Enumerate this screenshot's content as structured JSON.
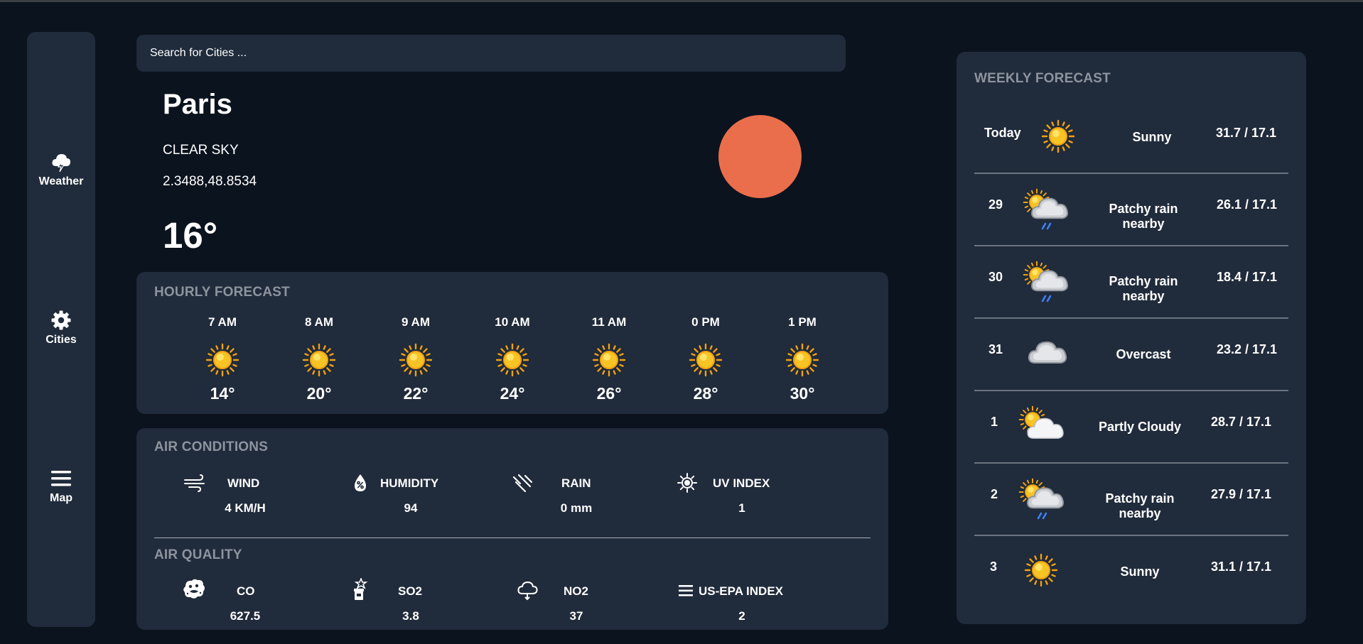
{
  "search": {
    "placeholder": "Search for Cities ..."
  },
  "sidebar": {
    "items": [
      {
        "label": "Weather",
        "icon": "cloud-lightning-icon"
      },
      {
        "label": "Cities",
        "icon": "gear-icon"
      },
      {
        "label": "Map",
        "icon": "menu-icon"
      }
    ]
  },
  "current": {
    "city": "Paris",
    "condition": "CLEAR SKY",
    "coords": "2.3488,48.8534",
    "temp": "16°",
    "icon": "sun-disc-icon",
    "accent": "#ea6e4b"
  },
  "hourly": {
    "title": "HOURLY FORECAST",
    "items": [
      {
        "time": "7 AM",
        "temp": "14°",
        "icon": "sun-icon"
      },
      {
        "time": "8 AM",
        "temp": "20°",
        "icon": "sun-icon"
      },
      {
        "time": "9 AM",
        "temp": "22°",
        "icon": "sun-icon"
      },
      {
        "time": "10 AM",
        "temp": "24°",
        "icon": "sun-icon"
      },
      {
        "time": "11 AM",
        "temp": "26°",
        "icon": "sun-icon"
      },
      {
        "time": "0 PM",
        "temp": "28°",
        "icon": "sun-icon"
      },
      {
        "time": "1 PM",
        "temp": "30°",
        "icon": "sun-icon"
      }
    ]
  },
  "air_conditions": {
    "title": "AIR CONDITIONS",
    "items": [
      {
        "label": "WIND",
        "value": "4 KM/H",
        "icon": "wind-icon"
      },
      {
        "label": "HUMIDITY",
        "value": "94",
        "icon": "humidity-drop-icon"
      },
      {
        "label": "RAIN",
        "value": "0 mm",
        "icon": "rain-icon"
      },
      {
        "label": "UV INDEX",
        "value": "1",
        "icon": "sun-outline-icon"
      }
    ]
  },
  "air_quality": {
    "title": "AIR QUALITY",
    "items": [
      {
        "label": "CO",
        "value": "627.5",
        "icon": "smog-icon"
      },
      {
        "label": "SO2",
        "value": "3.8",
        "icon": "chemical-bottle-icon"
      },
      {
        "label": "NO2",
        "value": "37",
        "icon": "cloud-outline-icon"
      },
      {
        "label": "US-EPA INDEX",
        "value": "2",
        "icon": "menu-icon"
      }
    ]
  },
  "weekly": {
    "title": "WEEKLY FORECAST",
    "days": [
      {
        "day": "Today",
        "condition": "Sunny",
        "temps": "31.7 / 17.1",
        "icon": "sun-icon"
      },
      {
        "day": "29",
        "condition": "Patchy rain nearby",
        "temps": "26.1 / 17.1",
        "icon": "sun-cloud-rain-icon"
      },
      {
        "day": "30",
        "condition": "Patchy rain nearby",
        "temps": "18.4 / 17.1",
        "icon": "sun-cloud-rain-icon"
      },
      {
        "day": "31",
        "condition": "Overcast",
        "temps": "23.2 / 17.1",
        "icon": "cloud-icon"
      },
      {
        "day": "1",
        "condition": "Partly Cloudy",
        "temps": "28.7 / 17.1",
        "icon": "sun-cloud-icon"
      },
      {
        "day": "2",
        "condition": "Patchy rain nearby",
        "temps": "27.9 / 17.1",
        "icon": "sun-cloud-rain-icon"
      },
      {
        "day": "3",
        "condition": "Sunny",
        "temps": "31.1 / 17.1",
        "icon": "sun-icon"
      }
    ]
  },
  "colors": {
    "background": "#0b131e",
    "panel": "#202b3b",
    "muted": "#8d949e",
    "sun": "#f7c325",
    "rain": "#3b82f6"
  }
}
